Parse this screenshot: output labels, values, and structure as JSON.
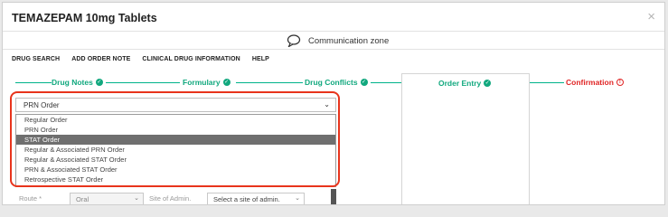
{
  "window": {
    "title": "TEMAZEPAM 10mg Tablets",
    "close": "×"
  },
  "comm_zone": {
    "label": "Communication zone",
    "icon": "speech-bubble-icon"
  },
  "menu": [
    "DRUG SEARCH",
    "ADD ORDER NOTE",
    "CLINICAL DRUG INFORMATION",
    "HELP"
  ],
  "steps": {
    "drug_notes": "Drug Notes",
    "formulary": "Formulary",
    "drug_conflicts": "Drug Conflicts",
    "order_entry": "Order Entry",
    "confirmation": "Confirmation",
    "done_icon": "✓",
    "warn_icon": "!"
  },
  "order_type": {
    "selected": "PRN Order",
    "chevron": "⌄",
    "options": [
      "Regular Order",
      "PRN Order",
      "STAT Order",
      "Regular & Associated PRN Order",
      "Regular & Associated STAT Order",
      "PRN & Associated STAT Order",
      "Retrospective STAT Order"
    ],
    "highlighted": "STAT Order"
  },
  "route_row": {
    "route_label": "Route *",
    "route_value": "Oral",
    "site_label": "Site of Admin.",
    "site_placeholder": "Select a site of admin.",
    "chevron": "⌄"
  },
  "colors": {
    "accent_green": "#11a87e",
    "alert_red": "#e02424",
    "highlight_border": "#e8341c"
  }
}
